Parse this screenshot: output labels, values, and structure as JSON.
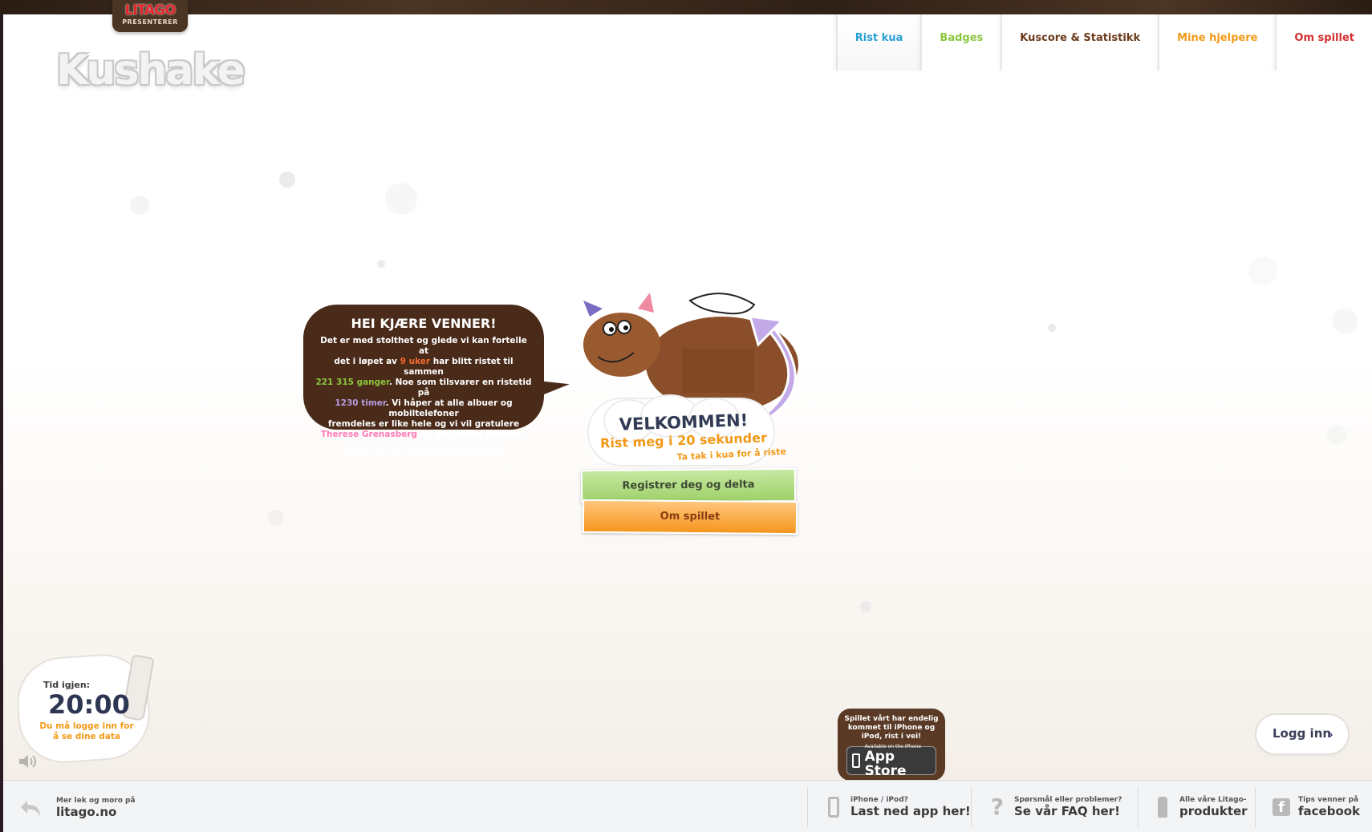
{
  "brand": {
    "badge_logo": "LITAGO",
    "badge_sub": "PRESENTERER",
    "app_logo": "Kushake"
  },
  "nav": [
    {
      "label": "Rist kua",
      "color": "#2aa0d6",
      "active": true
    },
    {
      "label": "Badges",
      "color": "#8cc63f",
      "active": false
    },
    {
      "label": "Kuscore & Statistikk",
      "color": "#6b3a1a",
      "active": false
    },
    {
      "label": "Mine hjelpere",
      "color": "#f29a18",
      "active": false
    },
    {
      "label": "Om spillet",
      "color": "#d32f2f",
      "active": false
    }
  ],
  "speech": {
    "title": "HEI KJÆRE VENNER!",
    "line1": "Det er med stolthet og glede vi kan fortelle at",
    "line2_pre": "det i løpet av ",
    "weeks": "9 uker",
    "line2_post": " har blitt ristet til sammen",
    "count": "221 315 ganger",
    "line3_post": ". Noe som tilsvarer en ristetid på",
    "hours": "1230 timer",
    "line4_post": ". Vi håper at alle albuer og mobiltelefoner",
    "line5": "fremdeles er like hele og vi vil gratulere",
    "winner": "Therese Grenasberg",
    "line6_post": " og alle andre shakere.",
    "link": "Klikk her for å se highscore-liste",
    "colors": {
      "weeks": "#f26b2e",
      "count": "#8cc63f",
      "hours": "#b89be0",
      "winner": "#ff7bb7"
    }
  },
  "welcome": {
    "title": "VELKOMMEN!",
    "subtitle": "Rist meg i 20 sekunder",
    "hint": "Ta tak i kua for å riste"
  },
  "buttons": {
    "register": "Registrer deg og delta",
    "about": "Om spillet"
  },
  "timer": {
    "label": "Tid igjen:",
    "value": "20:00",
    "note": "Du må logge inn for å se dine data"
  },
  "login": {
    "label": "Logg inn"
  },
  "app_promo": {
    "text": "Spillet vårt har endelig kommet til iPhone og iPod, rist i vei!",
    "store_small": "Available on the iPhone",
    "store_big": "App Store"
  },
  "footer": {
    "left_small": "Mer lek og moro på",
    "left_big": "litago.no",
    "items": [
      {
        "small": "iPhone / iPod?",
        "big": "Last ned app her!",
        "icon": "phone-icon"
      },
      {
        "small": "Spørsmål eller problemer?",
        "big": "Se vår FAQ her!",
        "icon": "question-icon"
      },
      {
        "small": "Alle våre Litago-",
        "big": "produkter",
        "icon": "bottle-icon"
      },
      {
        "small": "Tips venner på",
        "big": "facebook",
        "icon": "facebook-icon"
      }
    ]
  }
}
